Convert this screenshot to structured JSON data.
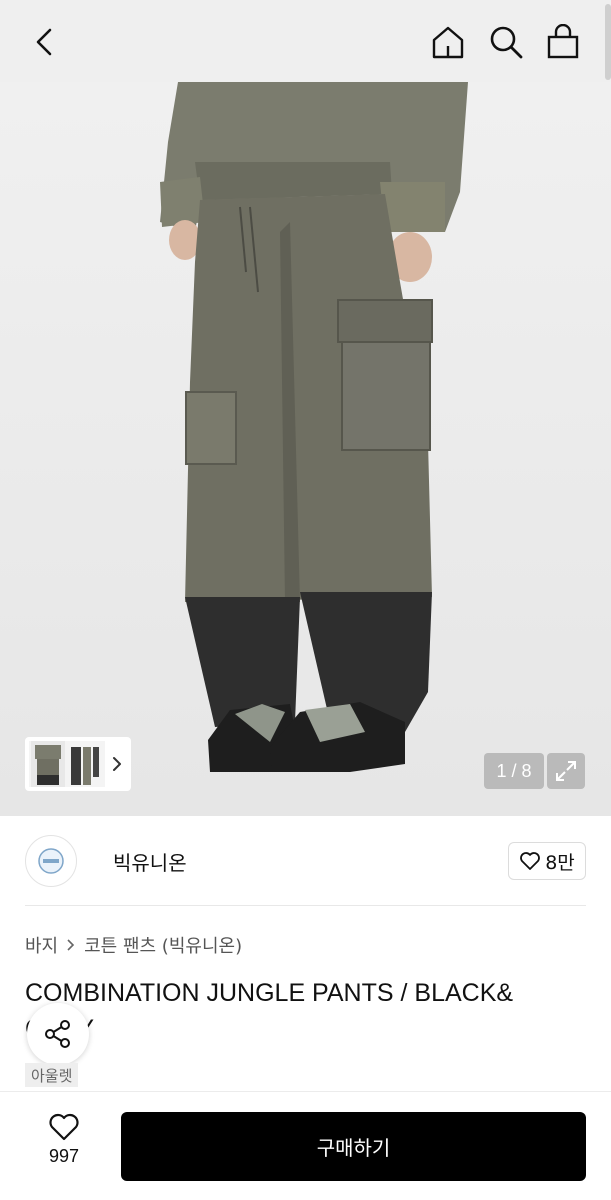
{
  "header": {
    "back_icon": "chevron-left-icon",
    "home_icon": "home-icon",
    "search_icon": "search-icon",
    "bag_icon": "shopping-bag-icon"
  },
  "gallery": {
    "counter": "1 / 8",
    "expand_icon": "expand-icon",
    "thumb_chevron_icon": "chevron-right-icon"
  },
  "brand": {
    "name": "빅유니온",
    "like_count": "8만"
  },
  "breadcrumb": {
    "category": "바지",
    "subcategory": "코튼 팬츠 (빅유니온)"
  },
  "product": {
    "title": "COMBINATION JUNGLE PANTS / BLACK& GRAY",
    "badge": "아울렛"
  },
  "bottom_bar": {
    "wish_count": "997",
    "buy_label": "구매하기"
  },
  "colors": {
    "buy_button": "#000000",
    "pants_gray": "#6f6f62",
    "pants_black": "#2e2e2e"
  }
}
